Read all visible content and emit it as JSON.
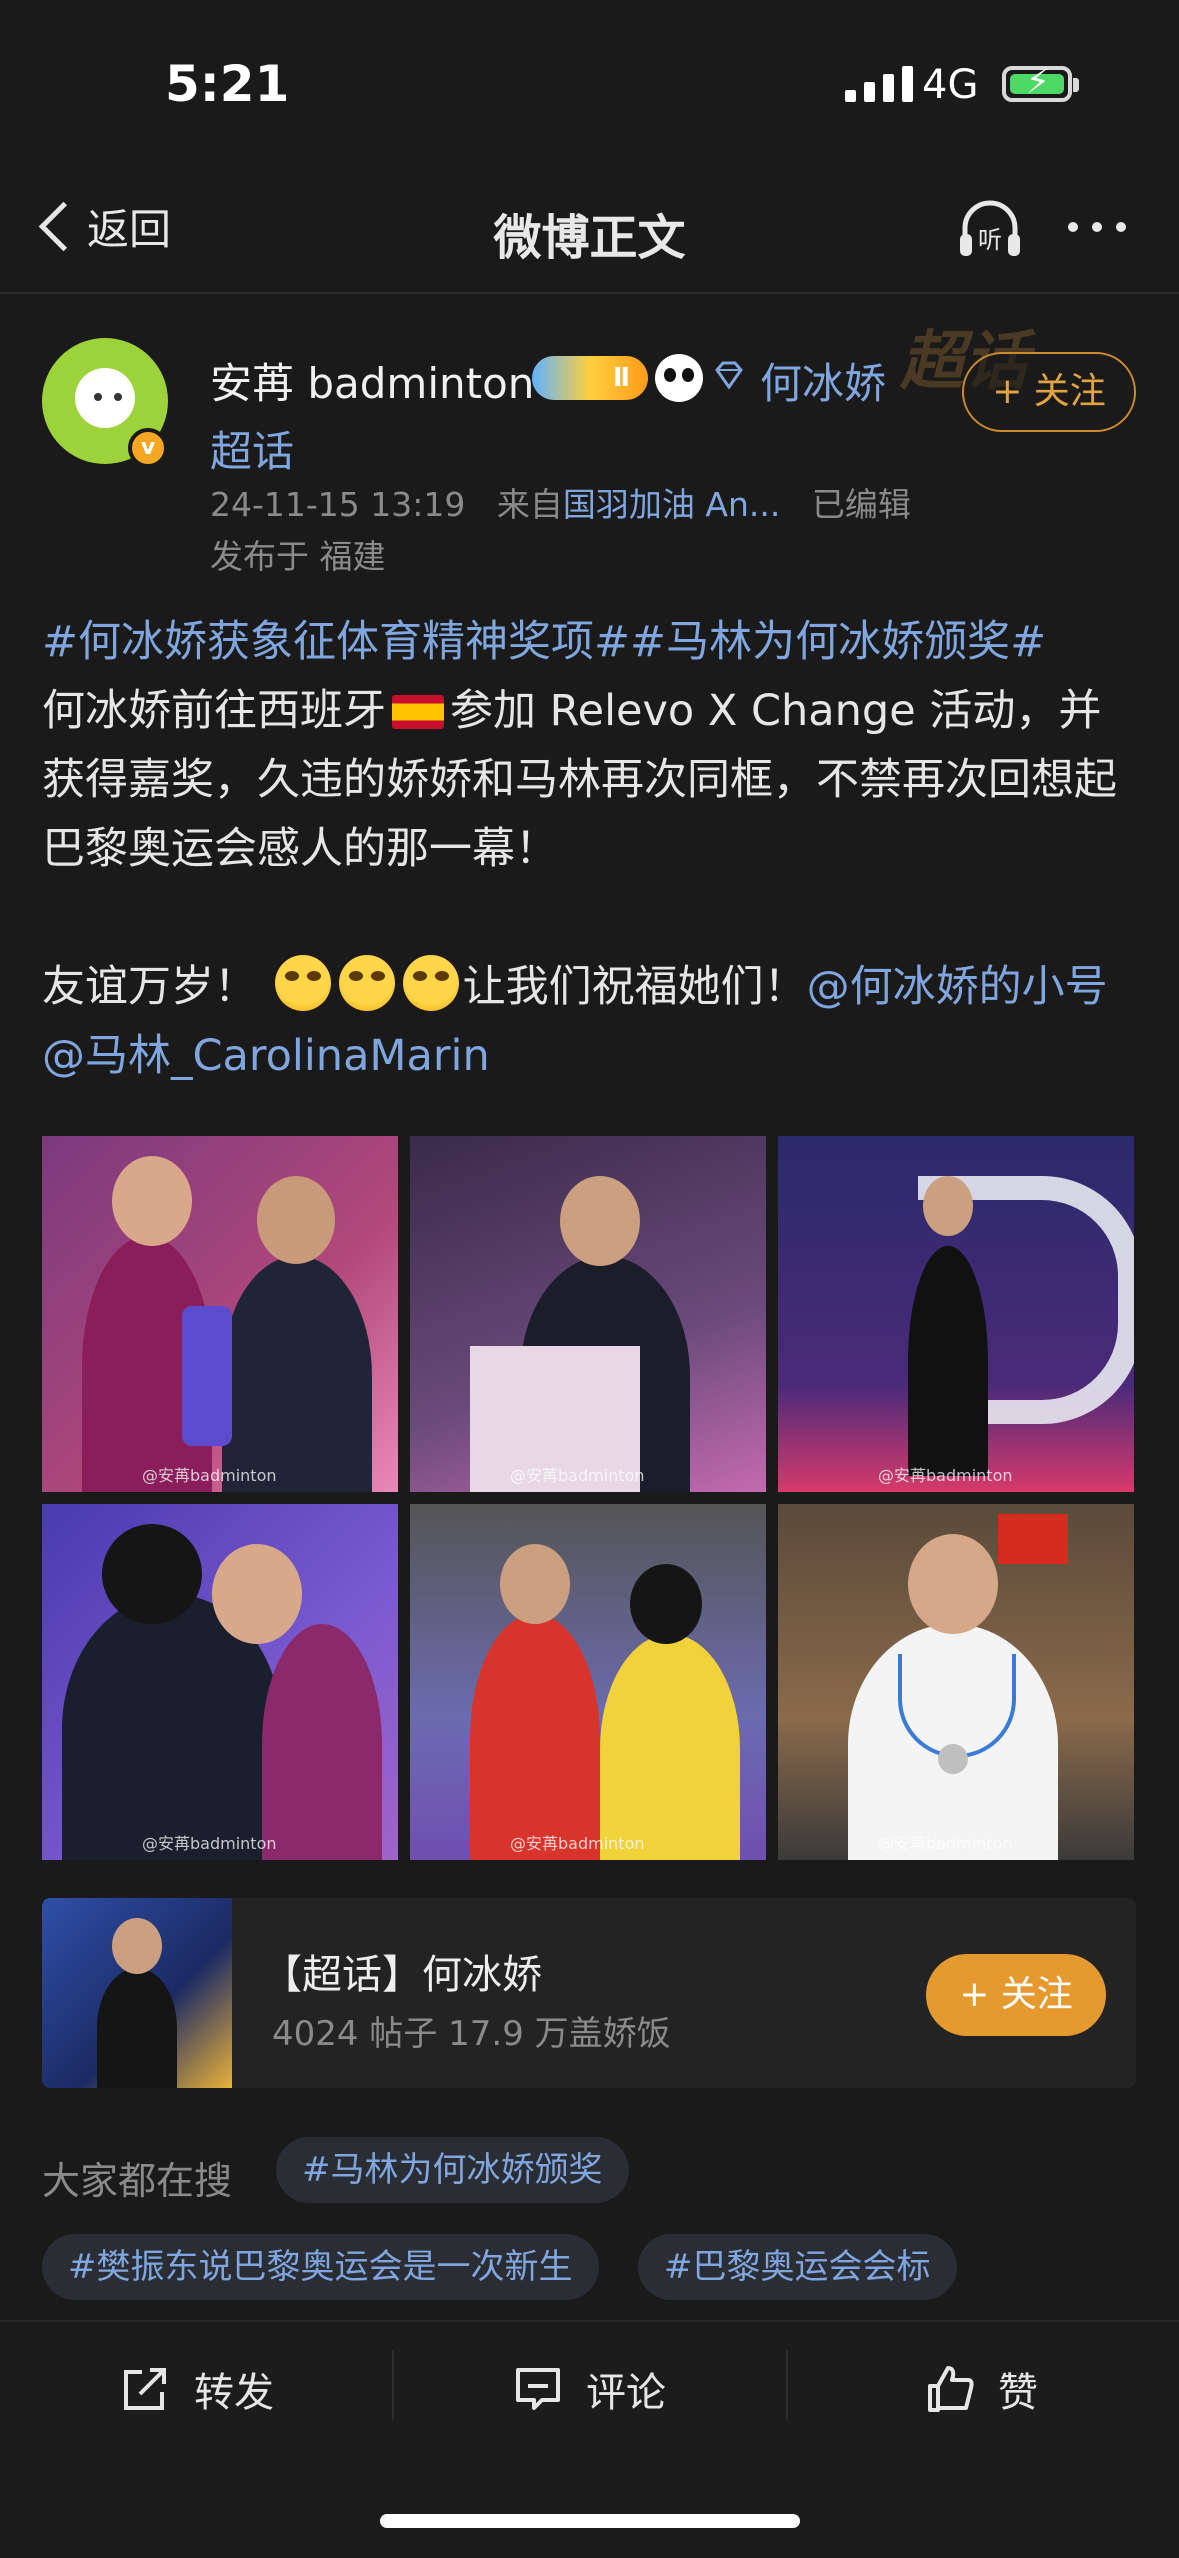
{
  "status_bar": {
    "time": "5:21",
    "network": "4G"
  },
  "nav": {
    "back_label": "返回",
    "title": "微博正文",
    "listen_label": "听"
  },
  "author": {
    "name": "安苒 badminton",
    "level_badge": "Ⅱ",
    "supertopic_link": "何冰娇",
    "supertopic_link_suffix": "超话",
    "watermark": "超话",
    "follow_label": "+ 关注",
    "timestamp": "24-11-15 13:19",
    "source_prefix": "来自",
    "source": "国羽加油 An...",
    "edited": "已编辑",
    "location": "发布于 福建"
  },
  "post": {
    "tags": "#何冰娇获象征体育精神奖项##马林为何冰娇颁奖#",
    "text1": "何冰娇前往西班牙",
    "text2": "参加 Relevo X Change 活动，并获得嘉奖，久违的娇娇和马林再次同框，不禁再次回想起巴黎奥运会感人的那一幕！",
    "text3": "友谊万岁！",
    "text4": "让我们祝福她们！",
    "mention1": "@何冰娇的小号",
    "mention2": "@马林_CarolinaMarin"
  },
  "photos": {
    "watermark": "@安苒badminton"
  },
  "topic_card": {
    "title": "【超话】何冰娇",
    "stats": "4024 帖子 17.9 万盖娇饭",
    "follow_label": "+ 关注"
  },
  "searches": {
    "label": "大家都在搜",
    "chips": [
      "#马林为何冰娇颁奖",
      "#樊振东说巴黎奥运会是一次新生",
      "#巴黎奥运会会标"
    ]
  },
  "actions": {
    "repost": "转发",
    "comment": "评论",
    "like": "赞"
  },
  "colors": {
    "link": "#7fa6df",
    "accent": "#e59a2f",
    "background": "#1a1a1a"
  }
}
